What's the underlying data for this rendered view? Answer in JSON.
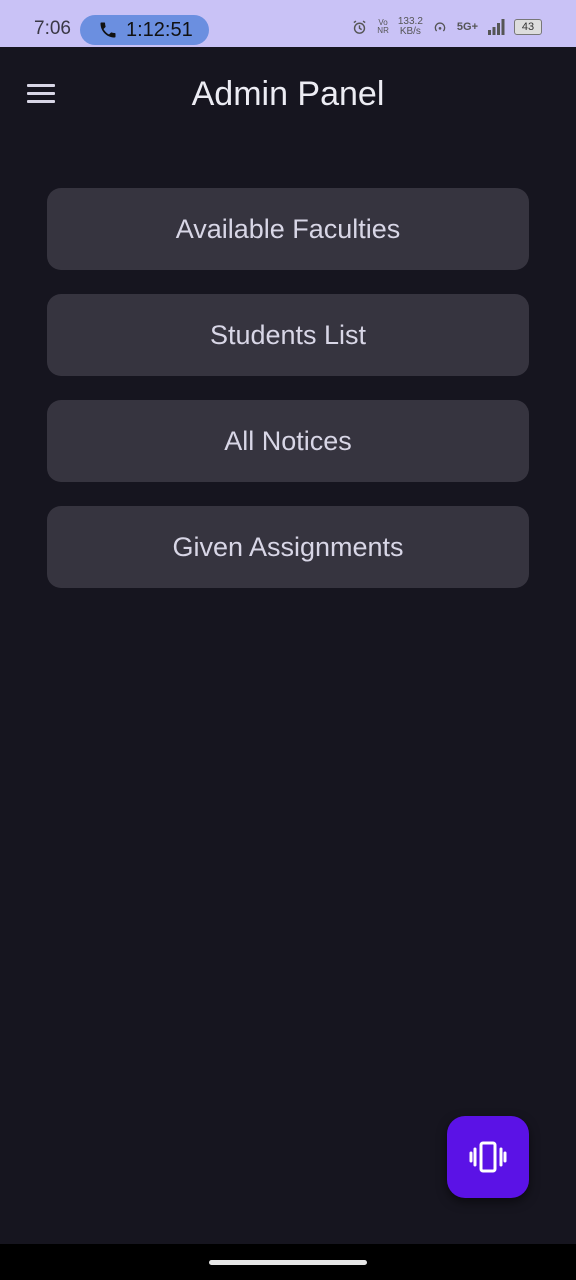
{
  "status_bar": {
    "time": "7:06",
    "call_duration": "1:12:51",
    "vo_label_top": "Vo",
    "vo_label_bottom": "NR",
    "speed_value": "133.2",
    "speed_unit": "KB/s",
    "network": "5G+",
    "battery": "43",
    "icons": [
      "phone-icon",
      "alarm-icon",
      "hotspot-icon",
      "signal-icon",
      "battery-icon"
    ]
  },
  "app_bar": {
    "title": "Admin Panel",
    "menu_icon": "hamburger-menu-icon"
  },
  "menu": {
    "items": [
      {
        "label": "Available Faculties"
      },
      {
        "label": "Students List"
      },
      {
        "label": "All Notices"
      },
      {
        "label": "Given Assignments"
      }
    ]
  },
  "fab": {
    "icon": "vibrate-icon",
    "color": "#5b12e6"
  },
  "colors": {
    "background": "#16151f",
    "status_bar": "#c9c2f6",
    "card": "#36343f",
    "call_pill": "#6b8fe0"
  }
}
